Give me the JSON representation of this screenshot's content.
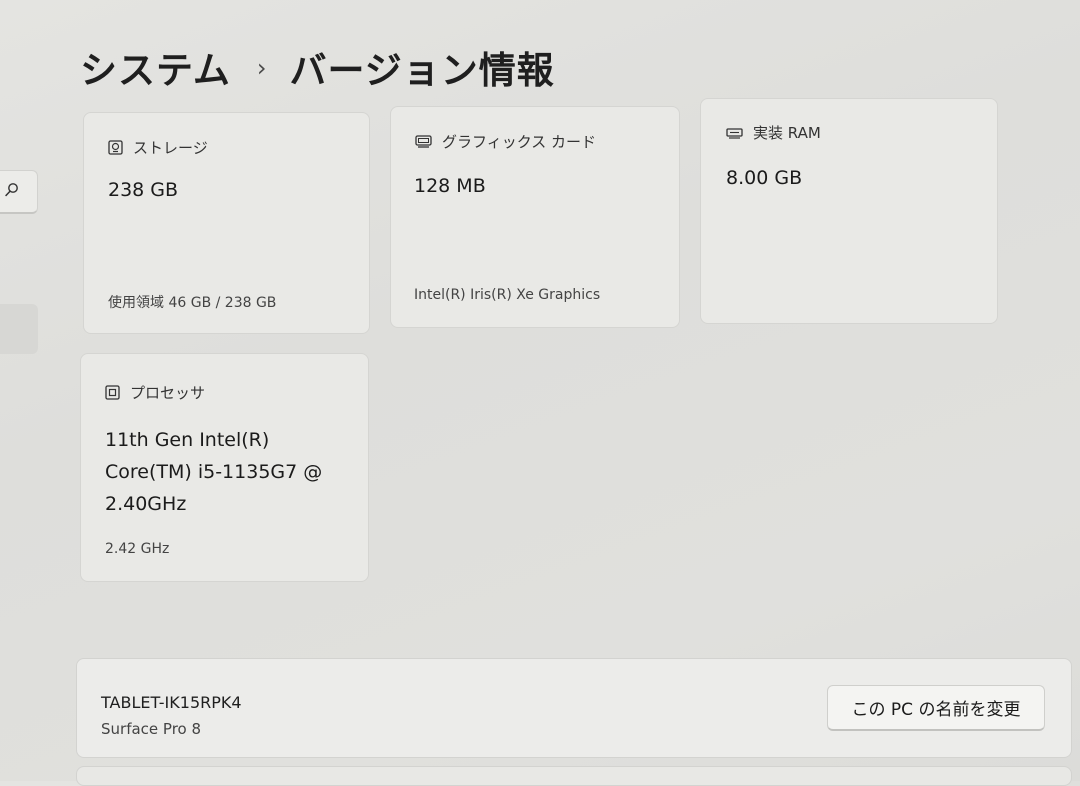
{
  "breadcrumb": {
    "parent": "システム",
    "separator": "›",
    "current": "バージョン情報"
  },
  "sidebar": {
    "search_icon": "search-icon"
  },
  "specs": {
    "storage": {
      "icon": "storage-icon",
      "title": "ストレージ",
      "value": "238 GB",
      "sub": "使用領域 46 GB / 238 GB"
    },
    "graphics": {
      "icon": "graphics-card-icon",
      "title": "グラフィックス カード",
      "value": "128 MB",
      "sub": "Intel(R) Iris(R) Xe Graphics"
    },
    "ram": {
      "icon": "ram-icon",
      "title": "実装 RAM",
      "value": "8.00 GB"
    },
    "processor": {
      "icon": "processor-icon",
      "title": "プロセッサ",
      "value_lines": [
        "11th Gen Intel(R)",
        "Core(TM) i5-1135G7 @",
        "2.40GHz"
      ],
      "sub": "2.42 GHz"
    }
  },
  "device": {
    "name": "TABLET-IK15RPK4",
    "model": "Surface Pro 8",
    "rename_button": "この PC の名前を変更"
  },
  "colors": {
    "background": "#e0e0dd",
    "card": "#e9e9e6",
    "text": "#1b1b1b"
  }
}
